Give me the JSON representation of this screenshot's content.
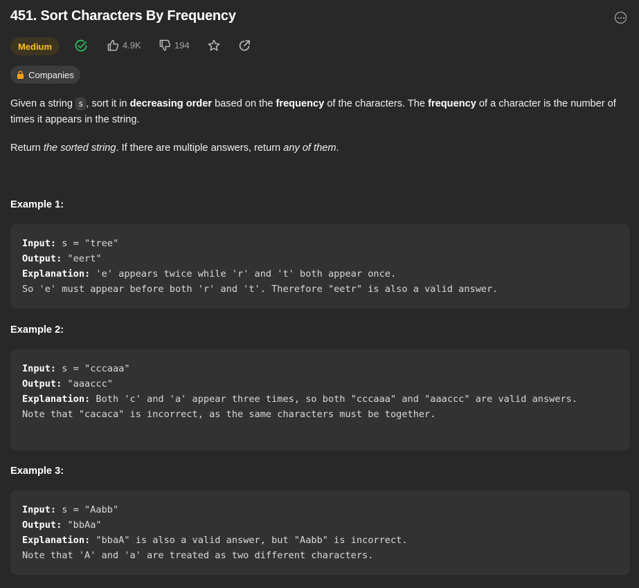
{
  "problem": {
    "title": "451. Sort Characters By Frequency",
    "difficulty": "Medium",
    "likes": "4.9K",
    "dislikes": "194",
    "companies_label": "Companies"
  },
  "description": {
    "p1": [
      {
        "t": "Given a string ",
        "s": "text"
      },
      {
        "t": "s",
        "s": "code"
      },
      {
        "t": ", sort it in ",
        "s": "text"
      },
      {
        "t": "decreasing order",
        "s": "bold"
      },
      {
        "t": " based on the ",
        "s": "text"
      },
      {
        "t": "frequency",
        "s": "bold"
      },
      {
        "t": " of the characters. The ",
        "s": "text"
      },
      {
        "t": "frequency",
        "s": "bold"
      },
      {
        "t": " of a character is the number of times it appears in the string.",
        "s": "text"
      }
    ],
    "p2": [
      {
        "t": "Return ",
        "s": "text"
      },
      {
        "t": "the sorted string",
        "s": "italic"
      },
      {
        "t": ". If there are multiple answers, return ",
        "s": "text"
      },
      {
        "t": "any of them",
        "s": "italic"
      },
      {
        "t": ".",
        "s": "text"
      }
    ]
  },
  "examples": [
    {
      "title": "Example 1:",
      "input_label": "Input:",
      "input": " s = \"tree\"",
      "output_label": "Output:",
      "output": " \"eert\"",
      "explanation_label": "Explanation:",
      "explanation": " 'e' appears twice while 'r' and 't' both appear once.\nSo 'e' must appear before both 'r' and 't'. Therefore \"eetr\" is also a valid answer."
    },
    {
      "title": "Example 2:",
      "input_label": "Input:",
      "input": " s = \"cccaaa\"",
      "output_label": "Output:",
      "output": " \"aaaccc\"",
      "explanation_label": "Explanation:",
      "explanation": " Both 'c' and 'a' appear three times, so both \"cccaaa\" and \"aaaccc\" are valid answers.\nNote that \"cacaca\" is incorrect, as the same characters must be together."
    },
    {
      "title": "Example 3:",
      "input_label": "Input:",
      "input": " s = \"Aabb\"",
      "output_label": "Output:",
      "output": " \"bbAa\"",
      "explanation_label": "Explanation:",
      "explanation": " \"bbaA\" is also a valid answer, but \"Aabb\" is incorrect.\nNote that 'A' and 'a' are treated as two different characters."
    }
  ],
  "icons": {
    "solved": "check-circle-icon",
    "like": "thumbs-up-icon",
    "dislike": "thumbs-down-icon",
    "favorite": "star-icon",
    "share": "share-icon",
    "lock": "lock-icon",
    "more": "more-options-icon"
  },
  "colors": {
    "background": "#282828",
    "medium": "#ffc01e",
    "solved": "#2cbb5d",
    "code_block": "#323232"
  }
}
